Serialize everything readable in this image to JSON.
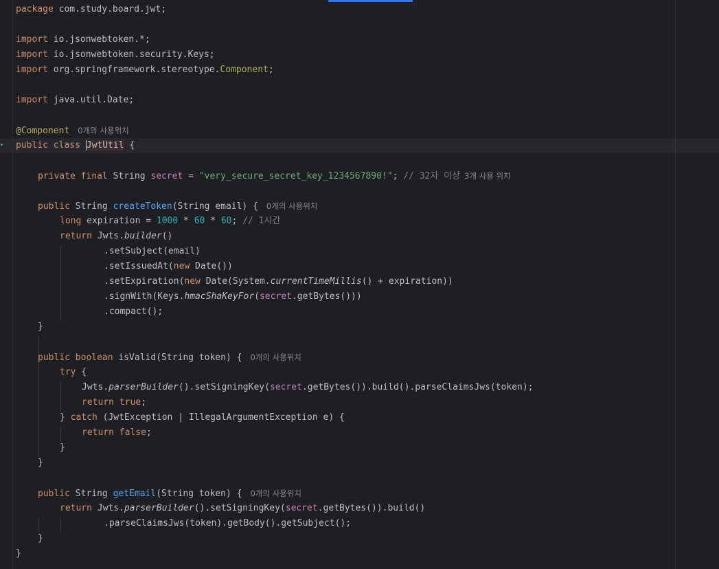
{
  "editor": {
    "package_line": {
      "kw": "package",
      "name": " com.study.board.jwt;"
    },
    "imports": [
      {
        "kw": "import",
        "path": " io.jsonwebtoken.*;"
      },
      {
        "kw": "import",
        "path": " io.jsonwebtoken.security.Keys;"
      },
      {
        "kw": "import",
        "path": " org.springframework.stereotype.",
        "cls": "Component",
        "end": ";"
      },
      {
        "kw": "import",
        "path": " java.util.Date;"
      }
    ],
    "annotation": {
      "text": "@Component",
      "hint": "0개의 사용위치"
    },
    "class_decl": {
      "kw": "public class ",
      "name": "JwtUtil",
      "rest": " {"
    },
    "secret_field": {
      "mods": "private final",
      "type": " String ",
      "name": "secret",
      "eq": " = ",
      "value": "\"very_secure_secret_key_1234567890!\"",
      "semi": ";",
      "comment": " // 32자 이상",
      "hint": "3개 사용 위치"
    },
    "create_token": {
      "sig_kw": "public",
      "sig_type": " String ",
      "sig_name": "createToken",
      "sig_params": "(String email) {",
      "hint": "0개의 사용위치",
      "exp_kw": "long",
      "exp_var": " expiration = ",
      "exp_a": "1000",
      "exp_op1": " * ",
      "exp_b": "60",
      "exp_op2": " * ",
      "exp_c": "60",
      "exp_semi": ";",
      "exp_comment": " // 1시간",
      "ret_kw": "return",
      "ret_a": " Jwts.",
      "ret_b": "builder",
      "ret_c": "()",
      "c1": ".setSubject(email)",
      "c2_a": ".setIssuedAt(",
      "c2_kw": "new",
      "c2_b": " Date())",
      "c3_a": ".setExpiration(",
      "c3_kw": "new",
      "c3_b": " Date(System.",
      "c3_st": "currentTimeMillis",
      "c3_c": "() + expiration))",
      "c4_a": ".signWith(Keys.",
      "c4_st": "hmacShaKeyFor",
      "c4_b": "(",
      "c4_fld": "secret",
      "c4_c": ".getBytes()))",
      "c5": ".compact();",
      "close": "}"
    },
    "is_valid": {
      "sig_kw": "public boolean",
      "sig_name": " isValid",
      "sig_params": "(String token) {",
      "hint": "0개의 사용위치",
      "try_kw": "try",
      "try_rest": " {",
      "p_a": "Jwts.",
      "p_st": "parserBuilder",
      "p_b": "().setSigningKey(",
      "p_fld": "secret",
      "p_c": ".getBytes()).build().parseClaimsJws(token);",
      "rt_kw": "return",
      "rt_val": " true",
      "rt_semi": ";",
      "catch_a": "} ",
      "catch_kw": "catch",
      "catch_b": " (JwtException | IllegalArgumentException e) {",
      "rf_kw": "return",
      "rf_val": " false",
      "rf_semi": ";",
      "inner_close": "}",
      "close": "}"
    },
    "get_email": {
      "sig_kw": "public",
      "sig_type": " String ",
      "sig_name": "getEmail",
      "sig_params": "(String token) {",
      "hint": "0개의 사용위치",
      "ret_kw": "return",
      "ret_a": " Jwts.",
      "ret_st": "parserBuilder",
      "ret_b": "().setSigningKey(",
      "ret_fld": "secret",
      "ret_c": ".getBytes()).build()",
      "c1": ".parseClaimsJws(token).getBody().getSubject();",
      "close": "}"
    },
    "class_close": "}"
  }
}
